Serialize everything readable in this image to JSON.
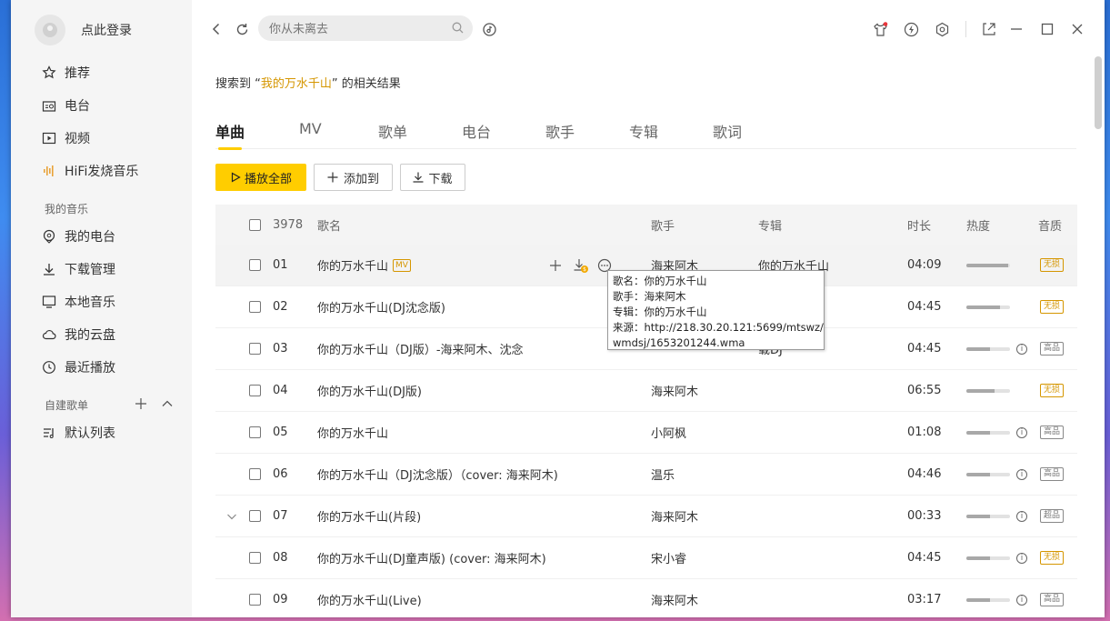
{
  "sidebar": {
    "login": "点此登录",
    "nav": [
      {
        "label": "推荐",
        "icon": "star-icon"
      },
      {
        "label": "电台",
        "icon": "radio-icon"
      },
      {
        "label": "视频",
        "icon": "video-icon"
      },
      {
        "label": "HiFi发烧音乐",
        "icon": "hifi-icon"
      }
    ],
    "my_music_title": "我的音乐",
    "my_music": [
      {
        "label": "我的电台",
        "icon": "location-radio-icon"
      },
      {
        "label": "下载管理",
        "icon": "download-icon"
      },
      {
        "label": "本地音乐",
        "icon": "monitor-icon"
      },
      {
        "label": "我的云盘",
        "icon": "cloud-icon"
      },
      {
        "label": "最近播放",
        "icon": "clock-icon"
      }
    ],
    "playlist_title": "自建歌单",
    "playlists": [
      {
        "label": "默认列表",
        "icon": "list-icon"
      }
    ]
  },
  "search": {
    "placeholder": "你从未离去"
  },
  "result": {
    "prefix": "搜索到 “",
    "keyword": "我的万水千山",
    "suffix": "” 的相关结果"
  },
  "tabs": [
    "单曲",
    "MV",
    "歌单",
    "电台",
    "歌手",
    "专辑",
    "歌词"
  ],
  "actions": {
    "play_all": "播放全部",
    "add_to": "添加到",
    "download": "下载"
  },
  "table": {
    "count": "3978",
    "headers": {
      "name": "歌名",
      "artist": "歌手",
      "album": "专辑",
      "duration": "时长",
      "heat": "热度",
      "quality": "音质"
    },
    "rows": [
      {
        "no": "01",
        "name": "你的万水千山",
        "mv": "MV",
        "artist": "海来阿木",
        "album": "你的万水千山",
        "duration": "04:09",
        "heat": 0.95,
        "quality": "无损",
        "quality_style": "gold",
        "info": false
      },
      {
        "no": "02",
        "name": "你的万水千山(DJ沈念版)",
        "artist": "",
        "album": "",
        "duration": "04:45",
        "heat": 0.78,
        "quality": "无损",
        "quality_style": "gold",
        "info": false
      },
      {
        "no": "03",
        "name": "你的万水千山（DJ版）-海来阿木、沈念",
        "artist": "",
        "album": "载DJ",
        "duration": "04:45",
        "heat": 0.55,
        "quality": "高品",
        "quality_style": "gray",
        "info": true
      },
      {
        "no": "04",
        "name": "你的万水千山(DJ版)",
        "artist": "海来阿木",
        "album": "",
        "duration": "06:55",
        "heat": 0.65,
        "quality": "无损",
        "quality_style": "gold",
        "info": false
      },
      {
        "no": "05",
        "name": "你的万水千山",
        "artist": "小阿枫",
        "album": "",
        "duration": "01:08",
        "heat": 0.55,
        "quality": "高品",
        "quality_style": "gray",
        "info": true
      },
      {
        "no": "06",
        "name": "你的万水千山（DJ沈念版）（cover: 海来阿木)",
        "artist": "温乐",
        "album": "",
        "duration": "04:46",
        "heat": 0.55,
        "quality": "高品",
        "quality_style": "gray",
        "info": true
      },
      {
        "no": "07",
        "name": "你的万水千山(片段)",
        "artist": "海来阿木",
        "album": "",
        "duration": "00:33",
        "heat": 0.55,
        "quality": "超品",
        "quality_style": "gray",
        "info": true,
        "expand": true
      },
      {
        "no": "08",
        "name": "你的万水千山(DJ童声版) (cover: 海来阿木)",
        "artist": "宋小睿",
        "album": "",
        "duration": "04:45",
        "heat": 0.55,
        "quality": "无损",
        "quality_style": "gold",
        "info": true
      },
      {
        "no": "09",
        "name": "你的万水千山(Live)",
        "artist": "海来阿木",
        "album": "",
        "duration": "03:17",
        "heat": 0.55,
        "quality": "高品",
        "quality_style": "gray",
        "info": true
      }
    ]
  },
  "tooltip": {
    "line1": "歌名：你的万水千山",
    "line2": "歌手：海来阿木",
    "line3": "专辑：你的万水千山",
    "line4": "来源：http://218.30.20.121:5699/mtswz/",
    "line5": "wmdsj/1653201244.wma"
  }
}
